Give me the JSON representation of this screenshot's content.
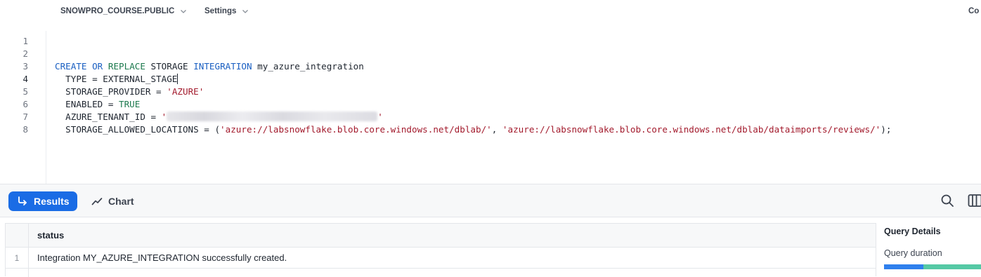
{
  "toolbar": {
    "context": "SNOWPRO_COURSE.PUBLIC",
    "settings": "Settings",
    "right_cut": "Co"
  },
  "editor": {
    "line_numbers": [
      "1",
      "2",
      "3",
      "4",
      "5",
      "6",
      "7",
      "8"
    ],
    "active_line": "4",
    "lines": {
      "l3": {
        "k1": "CREATE",
        "k2": "OR",
        "k3": "REPLACE",
        "plain1": " STORAGE ",
        "k4": "INTEGRATION",
        "plain2": " my_azure_integration"
      },
      "l4": {
        "text": "  TYPE = EXTERNAL_STAGE"
      },
      "l5": {
        "plain": "  STORAGE_PROVIDER = ",
        "str": "'AZURE'"
      },
      "l6": {
        "plain": "  ENABLED = ",
        "kw": "TRUE"
      },
      "l7": {
        "plain": "  AZURE_TENANT_ID = ",
        "q1": "'",
        "q2": "'"
      },
      "l8": {
        "plain1": "  STORAGE_ALLOWED_LOCATIONS = (",
        "str1": "'azure://labsnowflake.blob.core.windows.net/dblab/'",
        "plain2": ", ",
        "str2": "'azure://labsnowflake.blob.core.windows.net/dblab/dataimports/reviews/'",
        "plain3": ");"
      }
    }
  },
  "results_bar": {
    "results_label": "Results",
    "chart_label": "Chart",
    "icons": [
      "return-arrow-icon",
      "line-chart-icon",
      "search-icon",
      "columns-icon"
    ]
  },
  "table": {
    "columns": [
      "status"
    ],
    "rows": [
      {
        "index": "1",
        "status": "Integration MY_AZURE_INTEGRATION successfully created."
      }
    ]
  },
  "query_details": {
    "title": "Query Details",
    "duration_label": "Query duration"
  },
  "colors": {
    "accent": "#1a6ce5",
    "keyword_blue": "#1a5fc2",
    "keyword_green": "#1d7a4e",
    "string_red": "#a31b2d",
    "duration_bar_1": "#2f80ed",
    "duration_bar_2": "#55c9a5"
  }
}
